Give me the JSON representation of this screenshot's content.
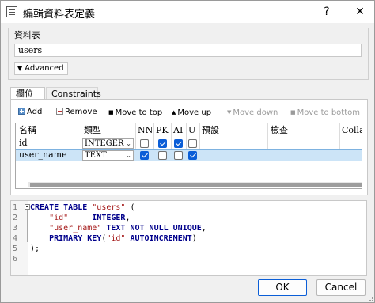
{
  "window": {
    "title": "編輯資料表定義",
    "help": "?",
    "close": "✕"
  },
  "table_group": {
    "label": "資料表",
    "name_value": "users",
    "advanced_label": "Advanced"
  },
  "tabs": [
    {
      "label": "欄位"
    },
    {
      "label": "Constraints"
    }
  ],
  "toolbar": {
    "add": "Add",
    "remove": "Remove",
    "move_top": "Move to top",
    "move_up": "Move up",
    "move_down": "Move down",
    "move_bottom": "Move to bottom"
  },
  "columns_grid": {
    "headers": [
      "名稱",
      "類型",
      "NN",
      "PK",
      "AI",
      "U",
      "預設",
      "檢查",
      "Colla"
    ],
    "rows": [
      {
        "name": "id",
        "type": "INTEGER",
        "nn": false,
        "pk": true,
        "ai": true,
        "u": false
      },
      {
        "name": "user_name",
        "type": "TEXT",
        "nn": true,
        "pk": false,
        "ai": false,
        "u": true
      }
    ]
  },
  "sql": {
    "line_numbers": [
      "1",
      "2",
      "3",
      "4",
      "5",
      "6"
    ],
    "lines": [
      [
        [
          "kw",
          "CREATE TABLE "
        ],
        [
          "str",
          "\"users\""
        ],
        [
          "plain",
          " ("
        ]
      ],
      [
        [
          "plain",
          "    "
        ],
        [
          "str",
          "\"id\""
        ],
        [
          "plain",
          "     "
        ],
        [
          "kw",
          "INTEGER"
        ],
        [
          "plain",
          ","
        ]
      ],
      [
        [
          "plain",
          "    "
        ],
        [
          "str",
          "\"user_name\""
        ],
        [
          "plain",
          " "
        ],
        [
          "kw",
          "TEXT NOT NULL UNIQUE"
        ],
        [
          "plain",
          ","
        ]
      ],
      [
        [
          "plain",
          "    "
        ],
        [
          "kw",
          "PRIMARY KEY"
        ],
        [
          "plain",
          "("
        ],
        [
          "str",
          "\"id\""
        ],
        [
          "plain",
          " "
        ],
        [
          "kw",
          "AUTOINCREMENT"
        ],
        [
          "plain",
          ")"
        ]
      ],
      [
        [
          "plain",
          ");"
        ]
      ],
      []
    ]
  },
  "buttons": {
    "ok": "OK",
    "cancel": "Cancel"
  },
  "colors": {
    "selection": "#cce4f7",
    "check": "#0b5ed7",
    "keyword": "#00008b",
    "string": "#a31515"
  }
}
